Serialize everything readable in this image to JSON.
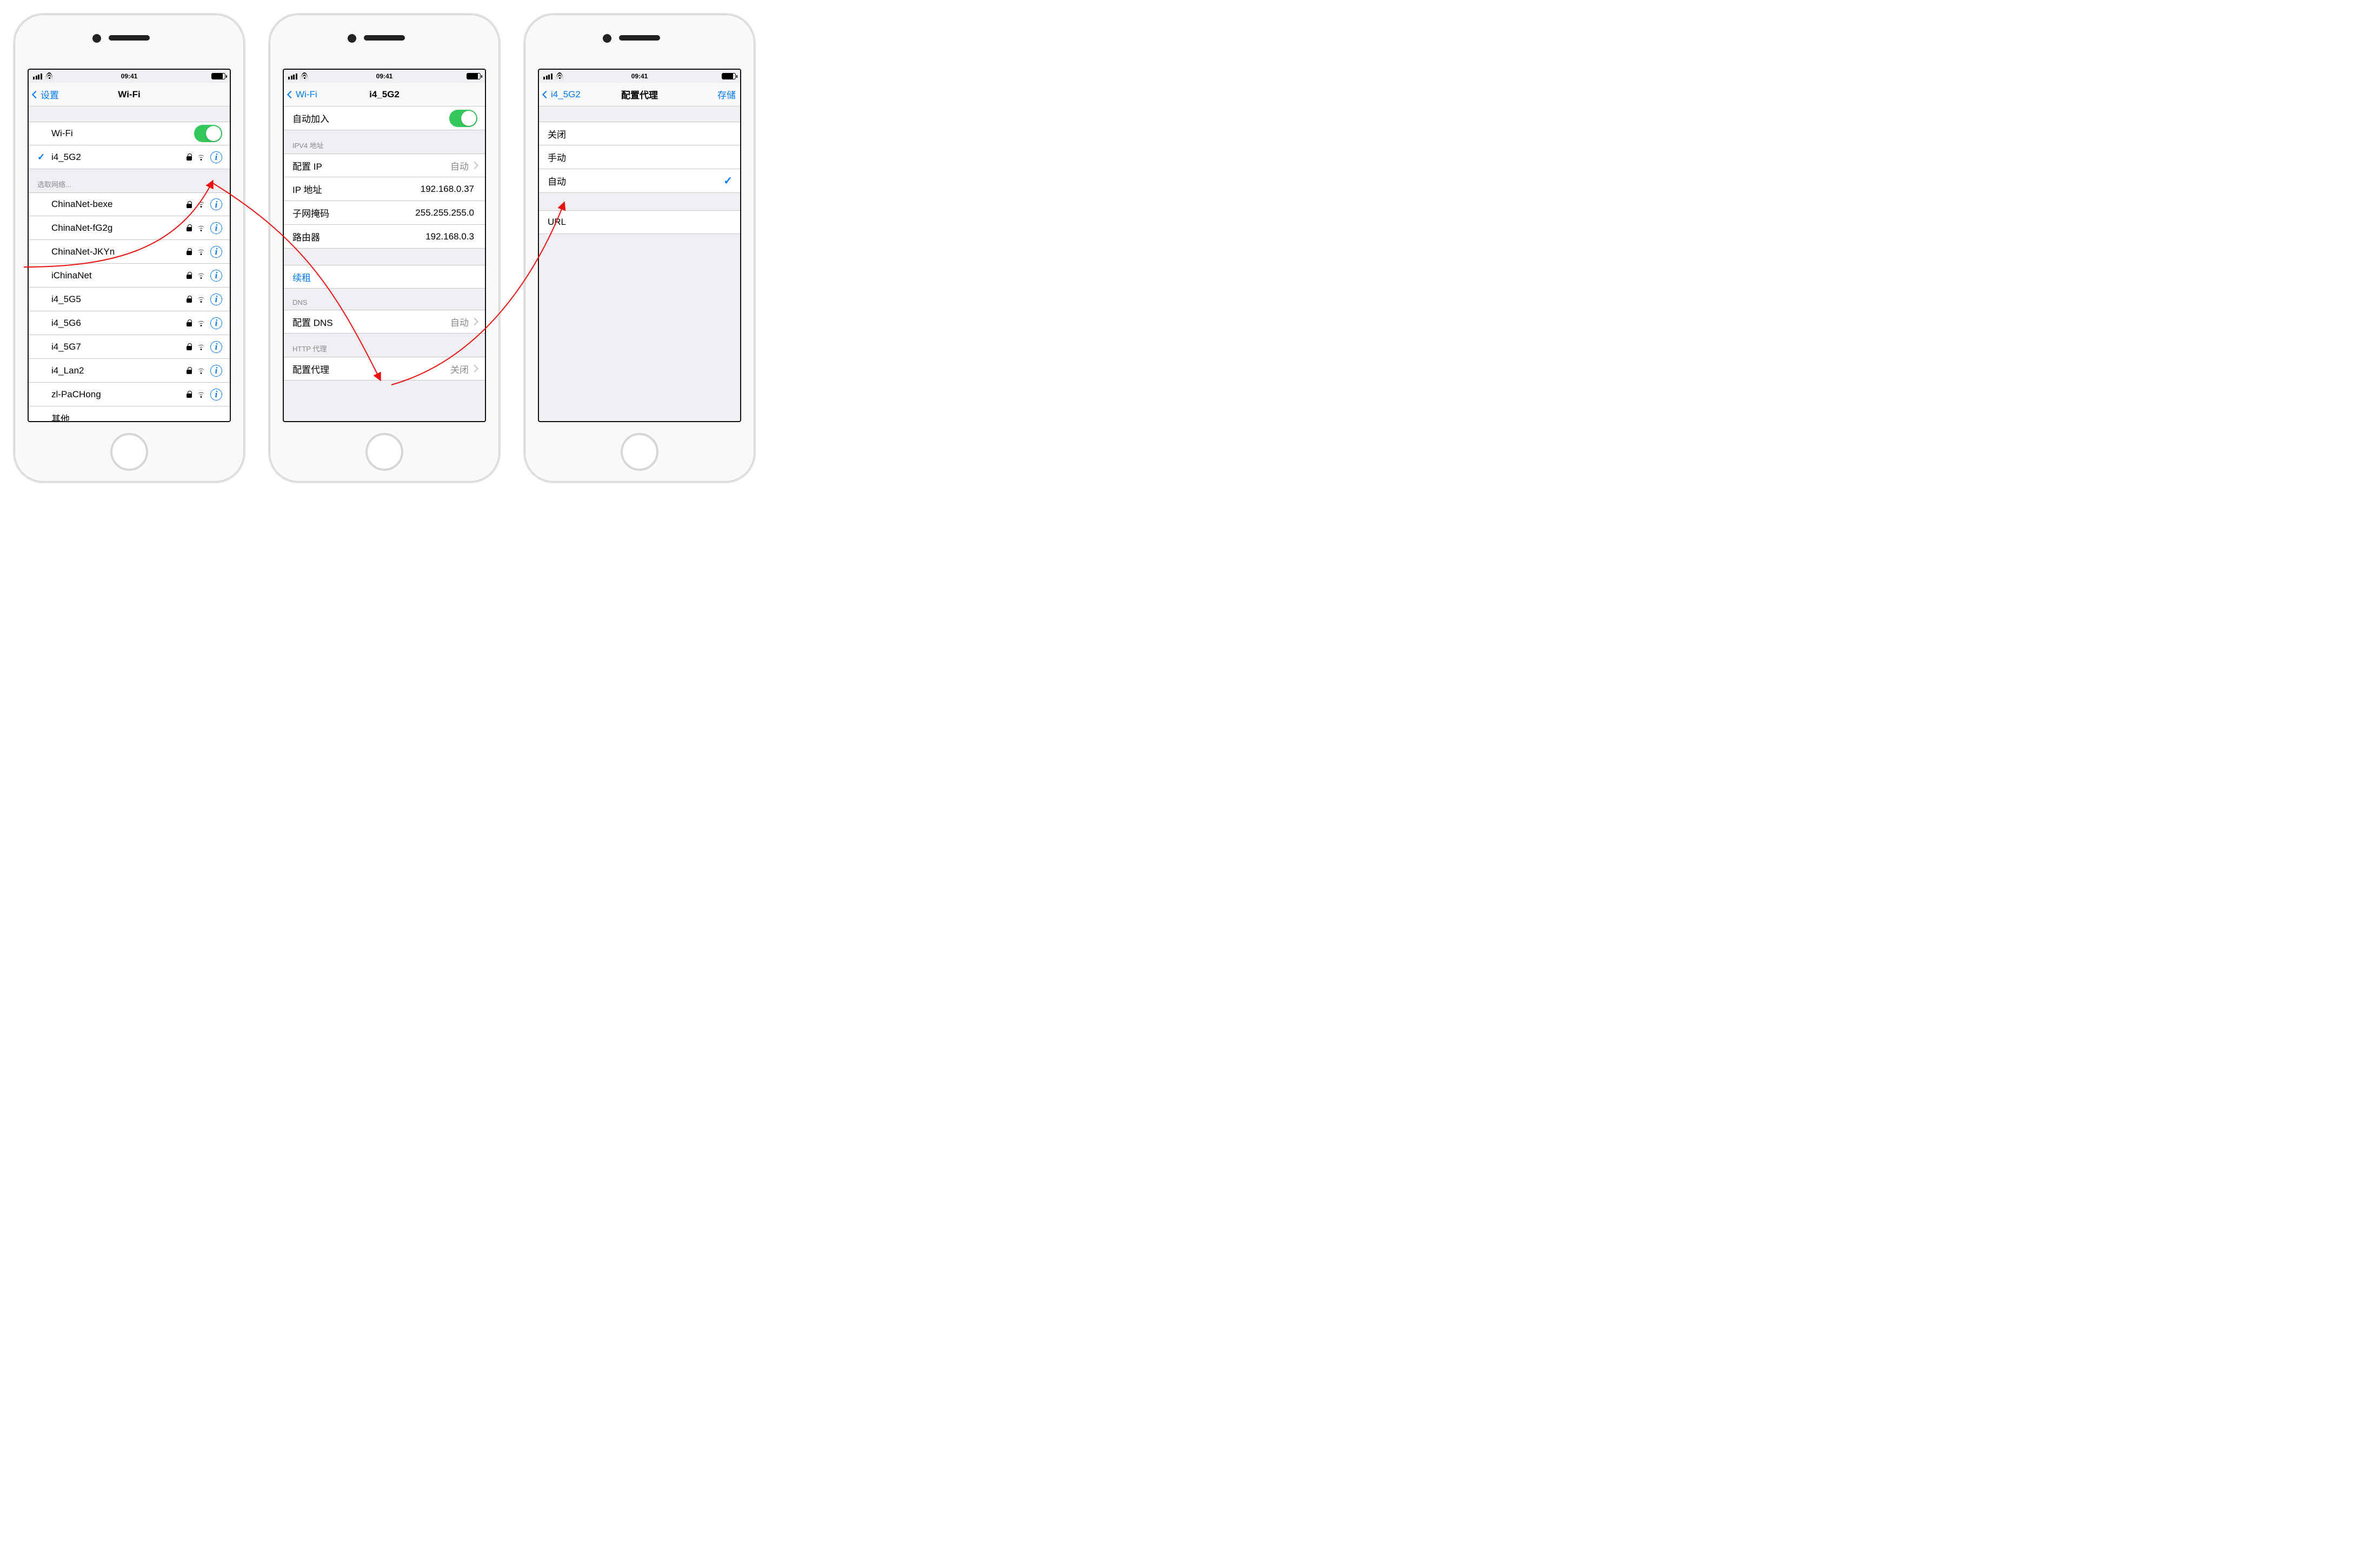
{
  "status": {
    "time": "09:41"
  },
  "phone1": {
    "back": "设置",
    "title": "Wi-Fi",
    "wifi_label": "Wi-Fi",
    "connected": {
      "name": "i4_5G2"
    },
    "choose_header": "选取网络...",
    "networks": [
      {
        "name": "ChinaNet-bexe"
      },
      {
        "name": "ChinaNet-fG2g"
      },
      {
        "name": "ChinaNet-JKYn"
      },
      {
        "name": "iChinaNet"
      },
      {
        "name": "i4_5G5"
      },
      {
        "name": "i4_5G6"
      },
      {
        "name": "i4_5G7"
      },
      {
        "name": "i4_Lan2"
      },
      {
        "name": "zl-PaCHong"
      }
    ],
    "other": "其他..."
  },
  "phone2": {
    "back": "Wi-Fi",
    "title": "i4_5G2",
    "autojoin": "自动加入",
    "ipv4_header": "IPV4 地址",
    "rows": {
      "configure_ip": {
        "label": "配置 IP",
        "value": "自动"
      },
      "ip": {
        "label": "IP 地址",
        "value": "192.168.0.37"
      },
      "mask": {
        "label": "子网掩码",
        "value": "255.255.255.0"
      },
      "router": {
        "label": "路由器",
        "value": "192.168.0.3"
      }
    },
    "renew": "续租",
    "dns_header": "DNS",
    "dns": {
      "label": "配置 DNS",
      "value": "自动"
    },
    "proxy_header": "HTTP 代理",
    "proxy": {
      "label": "配置代理",
      "value": "关闭"
    }
  },
  "phone3": {
    "back": "i4_5G2",
    "title": "配置代理",
    "save": "存储",
    "options": {
      "off": "关闭",
      "manual": "手动",
      "auto": "自动"
    },
    "url_label": "URL"
  }
}
